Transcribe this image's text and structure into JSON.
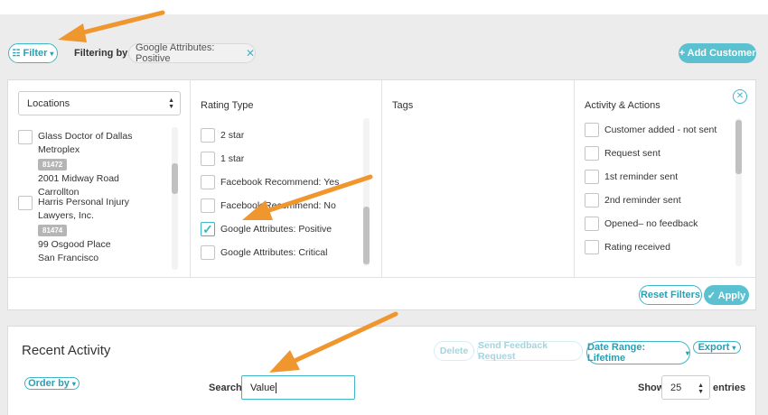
{
  "header": {
    "filter_label": "Filter",
    "filtering_by_label": "Filtering by:",
    "active_chip": "Google Attributes: Positive",
    "add_customer_label": "+ Add Customer"
  },
  "filters": {
    "locations": {
      "select_label": "Locations",
      "items": [
        {
          "name": "Glass Doctor of Dallas Metroplex",
          "id": "81472",
          "address": "2001 Midway Road",
          "city": "Carrollton",
          "checked": false
        },
        {
          "name": "Harris Personal Injury Lawyers, Inc.",
          "id": "81474",
          "address": "99 Osgood Place",
          "city": "San Francisco",
          "checked": false
        }
      ]
    },
    "rating_type": {
      "title": "Rating Type",
      "options": [
        {
          "label": "2 star",
          "checked": false
        },
        {
          "label": "1 star",
          "checked": false
        },
        {
          "label": "Facebook Recommend: Yes",
          "checked": false
        },
        {
          "label": "Facebook Recommend: No",
          "checked": false
        },
        {
          "label": "Google Attributes: Positive",
          "checked": true
        },
        {
          "label": "Google Attributes: Critical",
          "checked": false
        }
      ]
    },
    "tags": {
      "title": "Tags"
    },
    "activity": {
      "title": "Activity & Actions",
      "options": [
        {
          "label": "Customer added - not sent",
          "checked": false
        },
        {
          "label": "Request sent",
          "checked": false
        },
        {
          "label": "1st reminder sent",
          "checked": false
        },
        {
          "label": "2nd reminder sent",
          "checked": false
        },
        {
          "label": "Opened– no feedback",
          "checked": false
        },
        {
          "label": "Rating received",
          "checked": false
        }
      ]
    },
    "reset_label": "Reset Filters",
    "apply_label": "✓ Apply"
  },
  "recent": {
    "title": "Recent Activity",
    "delete_label": "Delete",
    "send_label": "Send Feedback Request",
    "date_range_label": "Date Range: Lifetime",
    "export_label": "Export",
    "order_by_label": "Order by",
    "search_label": "Search:",
    "search_value": "Value",
    "show_label": "Show",
    "entries_value": "25",
    "entries_label": "entries"
  },
  "colors": {
    "accent": "#3fb6c8",
    "accent_fill": "#5bc1d0",
    "annotation_arrow": "#f0962e",
    "background": "#ececec"
  },
  "icons": {
    "filter": "sliders-icon",
    "chip_remove": "close-icon",
    "panel_close": "circle-close-icon",
    "checked": "checkmark-icon",
    "dropdown": "caret-down-icon",
    "select": "updown-arrows-icon"
  }
}
